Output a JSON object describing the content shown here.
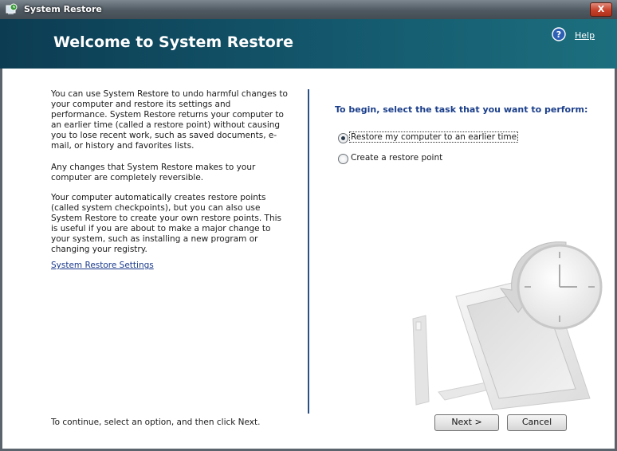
{
  "window": {
    "title": "System Restore",
    "icon": "system-restore-icon",
    "close_glyph": "X"
  },
  "header": {
    "title": "Welcome to System Restore",
    "help_label": "Help",
    "help_icon": "help-icon"
  },
  "left": {
    "paragraph1": "You can use System Restore to undo harmful changes to your computer and restore its settings and performance. System Restore returns your computer to an earlier time (called a restore point) without causing you to lose recent work, such as saved documents, e-mail, or history and favorites lists.",
    "paragraph2": "Any changes that System Restore makes to your computer are completely reversible.",
    "paragraph3": "Your computer automatically creates restore points (called system checkpoints), but you can also use System Restore to create your own restore points. This is useful if you are about to make a major change to your system, such as installing a new program or changing your registry.",
    "settings_link": "System Restore Settings",
    "continue_text": "To continue, select an option, and then click Next."
  },
  "right": {
    "heading": "To begin, select the task that you want to perform:",
    "options": [
      {
        "label": "Restore my computer to an earlier time",
        "selected": true
      },
      {
        "label": "Create a restore point",
        "selected": false
      }
    ]
  },
  "buttons": {
    "next_label": "Next >",
    "cancel_label": "Cancel"
  },
  "colors": {
    "header_bg": "#14586d",
    "heading_text": "#1a3e8a",
    "divider": "#2a4e86",
    "link": "#1a3a8c"
  }
}
